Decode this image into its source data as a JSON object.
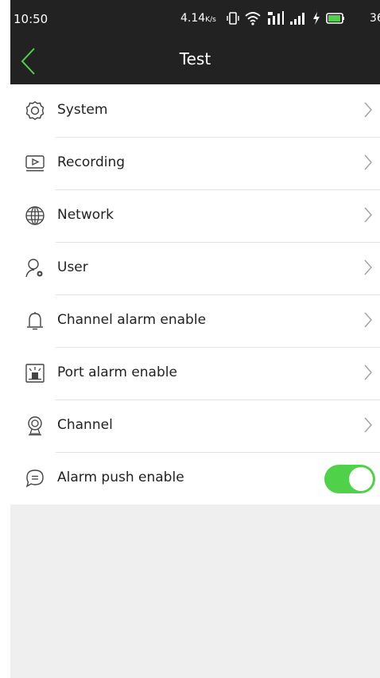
{
  "status_bar": {
    "time": "10:50",
    "net_speed": "4.14",
    "net_speed_unit": "K/s",
    "battery_text": "36"
  },
  "header": {
    "title": "Test"
  },
  "menu": {
    "items": [
      {
        "label": "System",
        "icon": "gear-icon"
      },
      {
        "label": "Recording",
        "icon": "recording-icon"
      },
      {
        "label": "Network",
        "icon": "globe-icon"
      },
      {
        "label": "User",
        "icon": "user-settings-icon"
      },
      {
        "label": "Channel alarm enable",
        "icon": "bell-icon"
      },
      {
        "label": "Port alarm enable",
        "icon": "port-alarm-icon"
      },
      {
        "label": "Channel",
        "icon": "webcam-icon"
      },
      {
        "label": "Alarm push enable",
        "icon": "chat-icon"
      }
    ],
    "alarm_push_enabled": true
  },
  "colors": {
    "header_bg": "#222222",
    "accent_green": "#4fd24a",
    "background": "#efefef"
  }
}
